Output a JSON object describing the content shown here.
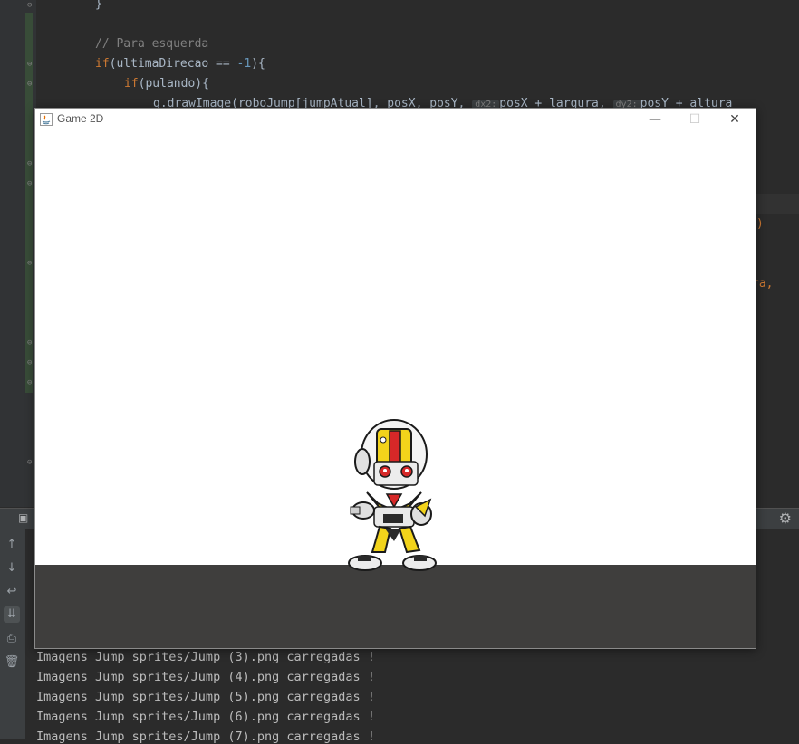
{
  "editor": {
    "lines": {
      "brace": "}",
      "comment": "// Para esquerda",
      "if_keyword": "if",
      "if_cond_open": "(ultimaDirecao == ",
      "if_cond_num": "-1",
      "if_cond_close": "){",
      "if2_keyword": "if",
      "if2_rest": "(pulando){",
      "draw_start": "g.drawImage(roboJump[jumpAtual], posX, posY, ",
      "hint_dx2": "dx2:",
      "draw_mid": "posX + largura, ",
      "hint_dy2": "dy2:",
      "draw_end": "posY + altura"
    },
    "right_fragments": [
      ")",
      "ra,"
    ]
  },
  "game_window": {
    "title": "Game 2D",
    "minimize_icon": "minimize-icon",
    "maximize_icon": "maximize-icon",
    "close_icon": "close-icon",
    "sprite": "robot-jump-sprite",
    "colors": {
      "sky": "#ffffff",
      "ground": "#3f3e3d",
      "robot_yellow": "#f2d31b",
      "robot_red": "#d62828"
    }
  },
  "run_panel": {
    "buttons": [
      "arrow-up-icon",
      "arrow-down-icon",
      "soft-wrap-icon",
      "scroll-to-end-icon",
      "print-icon",
      "trash-icon"
    ],
    "console_lines": [
      "Imagens Jump sprites/Jump (3).png carregadas !",
      "Imagens Jump sprites/Jump (4).png carregadas !",
      "Imagens Jump sprites/Jump (5).png carregadas !",
      "Imagens Jump sprites/Jump (6).png carregadas !",
      "Imagens Jump sprites/Jump (7).png carregadas !"
    ]
  }
}
